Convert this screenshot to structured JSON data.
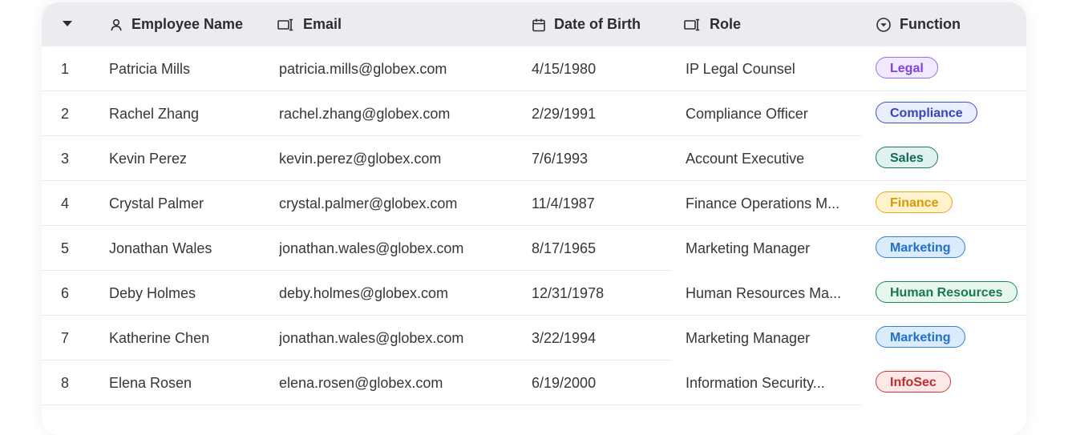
{
  "table": {
    "columns": {
      "name": "Employee Name",
      "email": "Email",
      "dob": "Date of Birth",
      "role": "Role",
      "function": "Function"
    },
    "rows": [
      {
        "index": "1",
        "name": "Patricia Mills",
        "email": "patricia.mills@globex.com",
        "dob": "4/15/1980",
        "role": "IP Legal Counsel",
        "function": "Legal"
      },
      {
        "index": "2",
        "name": "Rachel Zhang",
        "email": "rachel.zhang@globex.com",
        "dob": "2/29/1991",
        "role": "Compliance Officer",
        "function": "Compliance"
      },
      {
        "index": "3",
        "name": "Kevin Perez",
        "email": "kevin.perez@globex.com",
        "dob": "7/6/1993",
        "role": "Account Executive",
        "function": "Sales"
      },
      {
        "index": "4",
        "name": "Crystal Palmer",
        "email": "crystal.palmer@globex.com",
        "dob": "11/4/1987",
        "role": "Finance Operations M...",
        "function": "Finance"
      },
      {
        "index": "5",
        "name": "Jonathan Wales",
        "email": "jonathan.wales@globex.com",
        "dob": "8/17/1965",
        "role": "Marketing Manager",
        "function": "Marketing"
      },
      {
        "index": "6",
        "name": "Deby Holmes",
        "email": "deby.holmes@globex.com",
        "dob": "12/31/1978",
        "role": "Human Resources Ma...",
        "function": "Human Resources"
      },
      {
        "index": "7",
        "name": "Katherine Chen",
        "email": "jonathan.wales@globex.com",
        "dob": "3/22/1994",
        "role": "Marketing Manager",
        "function": "Marketing"
      },
      {
        "index": "8",
        "name": "Elena Rosen",
        "email": "elena.rosen@globex.com",
        "dob": "6/19/2000",
        "role": "Information Security...",
        "function": "InfoSec"
      }
    ]
  },
  "badge_colors": {
    "Legal": {
      "bg": "#f1e9ff",
      "border": "#9b6ce8",
      "text": "#7d43dd"
    },
    "Compliance": {
      "bg": "#ebeefe",
      "border": "#4053c9",
      "text": "#3546b8"
    },
    "Sales": {
      "bg": "#e2f3ef",
      "border": "#157a6b",
      "text": "#0f6b5e"
    },
    "Finance": {
      "bg": "#fff2cc",
      "border": "#e2ac16",
      "text": "#d69a05"
    },
    "Marketing": {
      "bg": "#dcebfc",
      "border": "#2f7fd6",
      "text": "#2171cc"
    },
    "Human Resources": {
      "bg": "#e8f7ee",
      "border": "#1a8a57",
      "text": "#167a4c"
    },
    "InfoSec": {
      "bg": "#fde8e8",
      "border": "#cc3a3a",
      "text": "#bf2c2c"
    }
  },
  "icons": {
    "caret": "caret-down-icon",
    "name": "person-icon",
    "email": "text-cursor-icon",
    "dob": "calendar-icon",
    "role": "text-cursor-icon",
    "function": "circle-chevron-down-icon"
  }
}
